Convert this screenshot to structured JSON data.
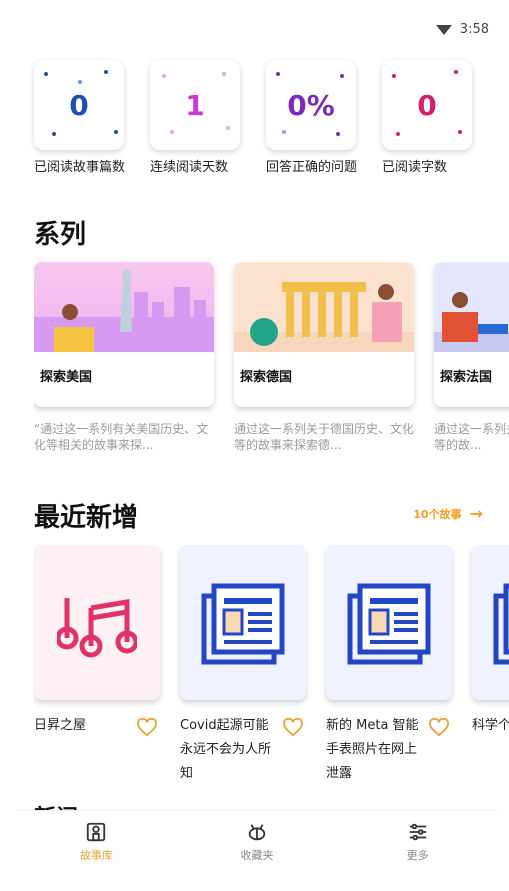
{
  "status_bar": {
    "time": "3:58",
    "wifi_icon": "wifi-icon"
  },
  "stats": [
    {
      "value": "0",
      "label": "已阅读故事篇数",
      "color": "#1f4fb0"
    },
    {
      "value": "1",
      "label": "连续阅读天数",
      "color": "#c83bd0"
    },
    {
      "value": "0%",
      "label": "回答正确的问题",
      "color": "#7a2bb8"
    },
    {
      "value": "0",
      "label": "已阅读字数",
      "color": "#d0226a"
    }
  ],
  "sections": {
    "series_title": "系列",
    "recent_title": "最近新增",
    "next_title": "新闻"
  },
  "series": [
    {
      "name": "探索美国",
      "description": "“通过这一系列有关美国历史、文化等相关的故事来探..."
    },
    {
      "name": "探索德国",
      "description": "通过这一系列关于德国历史、文化等的故事来探索德..."
    },
    {
      "name": "探索法国",
      "description": "通过这一系列关于法国历史、文化等的故..."
    }
  ],
  "recent_link": {
    "label": "10个故事",
    "arrow": "→"
  },
  "recent": [
    {
      "title": "日昇之屋",
      "icon": "music-notes-icon"
    },
    {
      "title": "Covid起源可能永远不会为人所知",
      "icon": "newspaper-icon"
    },
    {
      "title": "新的 Meta 智能手表照片在网上泄露",
      "icon": "newspaper-icon"
    },
    {
      "title": "科学个导因",
      "icon": "newspaper-icon"
    }
  ],
  "nav": [
    {
      "label": "故事库",
      "icon": "library-icon",
      "active": true
    },
    {
      "label": "收藏夹",
      "icon": "bee-icon",
      "active": false
    },
    {
      "label": "更多",
      "icon": "sliders-icon",
      "active": false
    }
  ],
  "colors": {
    "accent": "#e9a23b",
    "news_blue": "#2346c4",
    "music_pink": "#e0336a"
  }
}
